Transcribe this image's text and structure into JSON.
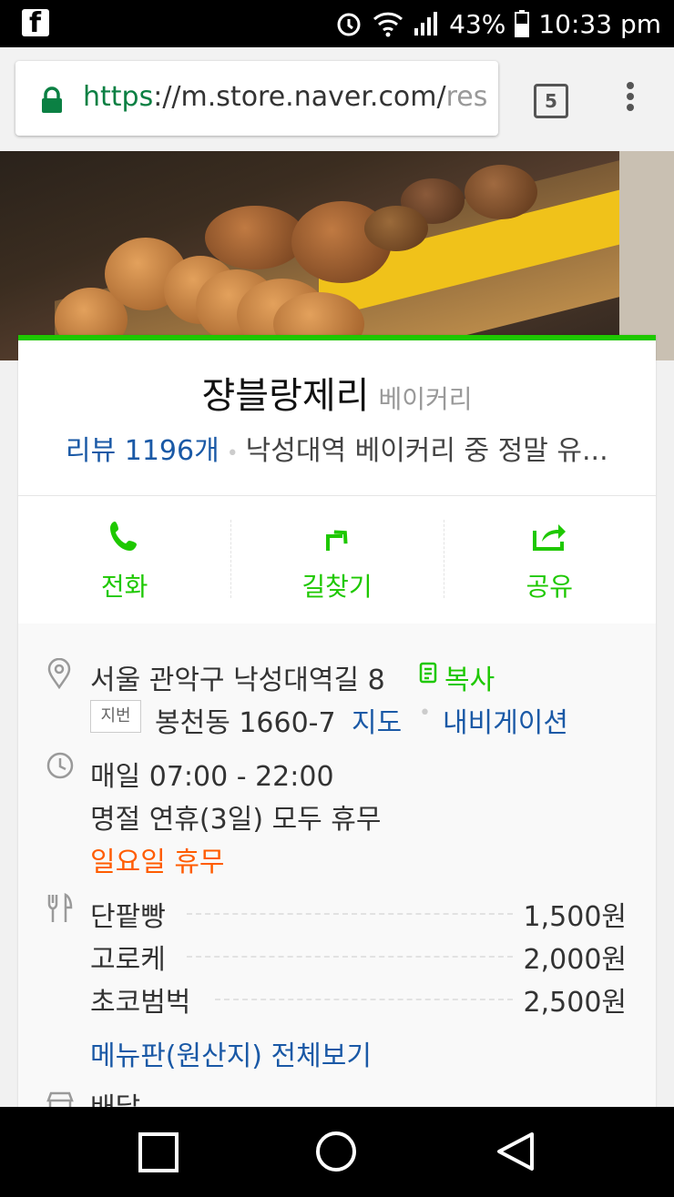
{
  "statusbar": {
    "battery": "43%",
    "time": "10:33 pm"
  },
  "browser": {
    "url_scheme": "https",
    "url_host": "://m.store.naver.com/",
    "url_rest": "res",
    "tab_count": "5"
  },
  "shop": {
    "name": "쟝블랑제리",
    "category": "베이커리",
    "review_label": "리뷰 1196개",
    "review_snippet": "낙성대역 베이커리 중 정말 유..."
  },
  "actions": [
    {
      "label": "전화"
    },
    {
      "label": "길찾기"
    },
    {
      "label": "공유"
    }
  ],
  "address": {
    "road": "서울 관악구 낙성대역길 8",
    "copy": "복사",
    "jibun_tag": "지번",
    "jibun": "봉천동 1660-7",
    "map": "지도",
    "navigation": "내비게이션"
  },
  "hours": {
    "daily": "매일 07:00 - 22:00",
    "holiday": "명절 연휴(3일) 모두 휴무",
    "closed": "일요일 휴무"
  },
  "menu": {
    "items": [
      {
        "name": "단팥빵",
        "price": "1,500원"
      },
      {
        "name": "고로케",
        "price": "2,000원"
      },
      {
        "name": "초코범벅",
        "price": "2,500원"
      }
    ],
    "view_all": "메뉴판(원산지) 전체보기"
  },
  "delivery": {
    "label": "배달"
  },
  "colors": {
    "accent": "#1ec800",
    "link": "#1a59a6",
    "warning": "#ff5c00"
  }
}
